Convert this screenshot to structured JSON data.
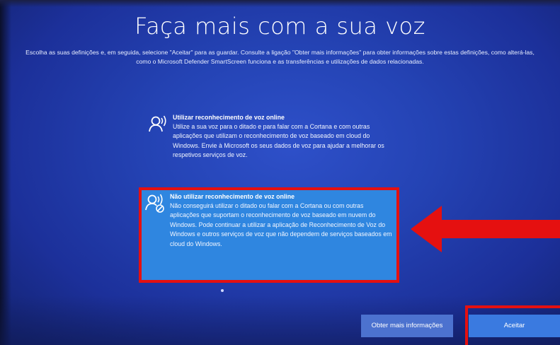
{
  "page": {
    "title": "Faça mais com a sua voz",
    "subtitle": "Escolha as suas definições e, em seguida, selecione \"Aceitar\" para as guardar. Consulte a ligação \"Obter mais informações\" para obter informações sobre estas definições, como alterá-las, como o Microsoft Defender SmartScreen funciona e as transferências e utilizações de dados relacionadas."
  },
  "options": [
    {
      "icon": "voice-recognition-icon",
      "title": "Utilizar reconhecimento de voz online",
      "description": "Utilize a sua voz para o ditado e para falar com a Cortana e com outras aplicações que utilizam o reconhecimento de voz baseado em cloud do Windows. Envie à Microsoft os seus dados de voz para ajudar a melhorar os respetivos serviços de voz.",
      "selected": false
    },
    {
      "icon": "voice-recognition-off-icon",
      "title": "Não utilizar reconhecimento de voz online",
      "description": "Não conseguirá utilizar o ditado ou falar com a Cortana ou com outras aplicações que suportam o reconhecimento de voz baseado em nuvem do Windows. Pode continuar a utilizar a aplicação de Reconhecimento de Voz do Windows e outros serviços de voz que não dependem de serviços baseados em cloud do Windows.",
      "selected": true
    }
  ],
  "buttons": {
    "more_info": "Obter mais informações",
    "accept": "Aceitar"
  },
  "annotations": {
    "color": "#e51010",
    "arrow_direction": "left"
  },
  "colors": {
    "background": "#2443b4",
    "selected_option": "#2f86e0",
    "accept_button": "#3a7ae0"
  }
}
